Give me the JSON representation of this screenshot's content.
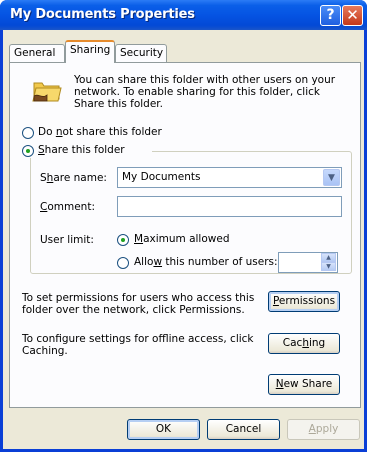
{
  "window": {
    "title": "My Documents Properties",
    "help_glyph": "?",
    "close_glyph": "✕"
  },
  "tabs": [
    {
      "label": "General"
    },
    {
      "label": "Sharing"
    },
    {
      "label": "Security"
    }
  ],
  "sharing": {
    "info_text": "You can share this folder with other users on your network.  To enable sharing for this folder, click Share this folder.",
    "do_not_share": {
      "pre": "Do ",
      "key": "n",
      "post": "ot share this folder",
      "selected": false
    },
    "share": {
      "pre": "",
      "key": "S",
      "post": "hare this folder",
      "selected": true
    },
    "share_name": {
      "pre": "S",
      "key": "h",
      "post": "are name:",
      "value": "My Documents"
    },
    "comment": {
      "pre": "",
      "key": "C",
      "post": "omment:",
      "value": ""
    },
    "user_limit": {
      "label": "User limit:",
      "maximum": {
        "pre": "",
        "key": "M",
        "post": "aximum allowed",
        "selected": true
      },
      "allow": {
        "pre": "Allo",
        "key": "w",
        "post": " this number of users:",
        "selected": false,
        "value": ""
      }
    },
    "permissions_text": "To set permissions for users who access this folder over the network, click Permissions.",
    "permissions_button": {
      "pre": "",
      "key": "P",
      "post": "ermissions"
    },
    "caching_text": "To configure settings for offline access, click Caching.",
    "caching_button": {
      "pre": "Cac",
      "key": "h",
      "post": "ing"
    },
    "new_share_button": {
      "pre": "",
      "key": "N",
      "post": "ew Share"
    }
  },
  "buttons": {
    "ok": "OK",
    "cancel": "Cancel",
    "apply": {
      "pre": "",
      "key": "A",
      "post": "pply"
    }
  }
}
